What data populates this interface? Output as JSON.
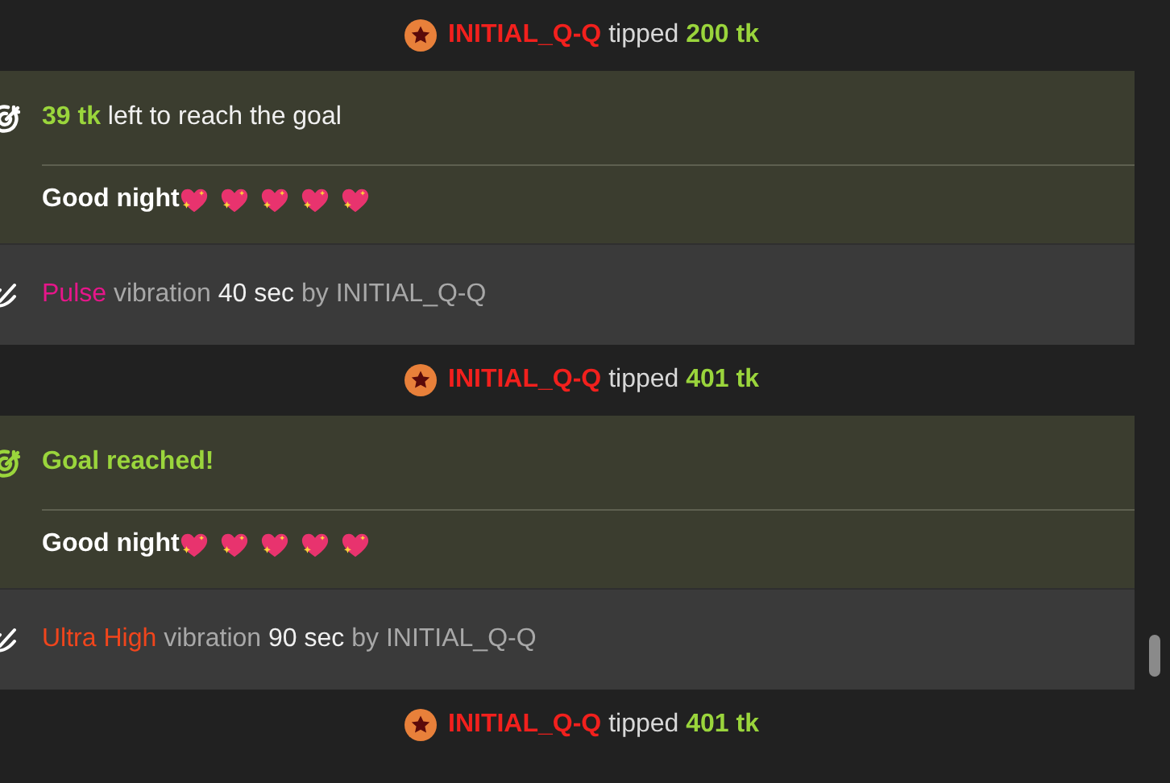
{
  "messages": [
    {
      "kind": "tip",
      "user": "INITIAL_Q-Q",
      "verb": "tipped",
      "amount": "200 tk"
    },
    {
      "kind": "goal",
      "reached": false,
      "amount": "39 tk",
      "text": "left to reach the goal",
      "subject": "Good night"
    },
    {
      "kind": "vibration",
      "level": "Pulse",
      "color": "#e6168a",
      "word": "vibration",
      "duration": "40 sec",
      "by": "by INITIAL_Q-Q"
    },
    {
      "kind": "tip",
      "user": "INITIAL_Q-Q",
      "verb": "tipped",
      "amount": "401 tk"
    },
    {
      "kind": "goal",
      "reached": true,
      "text": "Goal reached!",
      "subject": "Good night"
    },
    {
      "kind": "vibration",
      "level": "Ultra High",
      "color": "#f0451c",
      "word": "vibration",
      "duration": "90 sec",
      "by": "by INITIAL_Q-Q"
    },
    {
      "kind": "tip",
      "user": "INITIAL_Q-Q",
      "verb": "tipped",
      "amount": "401 tk"
    }
  ]
}
